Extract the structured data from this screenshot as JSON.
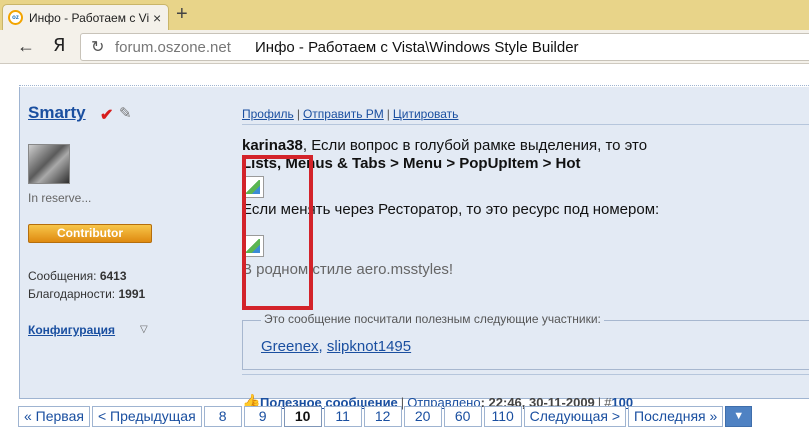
{
  "browser": {
    "tab_title": "Инфо - Работаем с Vi",
    "tab_close": "×",
    "new_tab": "+",
    "back": "←",
    "ya": "Я",
    "reload": "↻",
    "url_host": "forum.oszone.net",
    "page_title": "Инфо - Работаем с Vista\\Windows Style Builder",
    "favicon_text": "oz"
  },
  "sidebar": {
    "username": "Smarty",
    "check_icon": "✔",
    "brush_icon": "✎",
    "user_title": "In reserve...",
    "rank": "Contributor",
    "posts_label": "Сообщения:",
    "posts_value": "6413",
    "thanks_label": "Благодарности:",
    "thanks_value": "1991",
    "config": "Конфигурация",
    "config_arrow": "▽"
  },
  "actions": {
    "profile": "Профиль",
    "send_pm": "Отправить PM",
    "quote": "Цитировать",
    "sep": "|"
  },
  "body": {
    "mention": "karina38",
    "line1_rest": ", Если вопрос в голубой рамке выделения, то это",
    "line2": "Lists, Menus & Tabs > Menu > PopUpItem > Hot",
    "line3": "Если менять через Ресторатор, то это ресурс под номером:",
    "line4": "В родном стиле aero.msstyles!"
  },
  "thanks_box": {
    "legend": "Это сообщение посчитали полезным следующие участники:",
    "user1": "Greenex",
    "comma": ", ",
    "user2": "slipknot1495"
  },
  "footer": {
    "thumb_icon": "👍",
    "useful": "Полезное сообщение",
    "sep": "|",
    "sent_link": "Отправлено",
    "sent_time": ": 22:46, 30-11-2009",
    "post_no_prefix": "#",
    "post_no": "100"
  },
  "pager": {
    "first": "« Первая",
    "prev": "< Предыдущая",
    "pages": [
      "8",
      "9",
      "10",
      "11",
      "12",
      "20",
      "60",
      "110"
    ],
    "current": "10",
    "next": "Следующая >",
    "last": "Последняя »",
    "dropdown": "▼"
  }
}
